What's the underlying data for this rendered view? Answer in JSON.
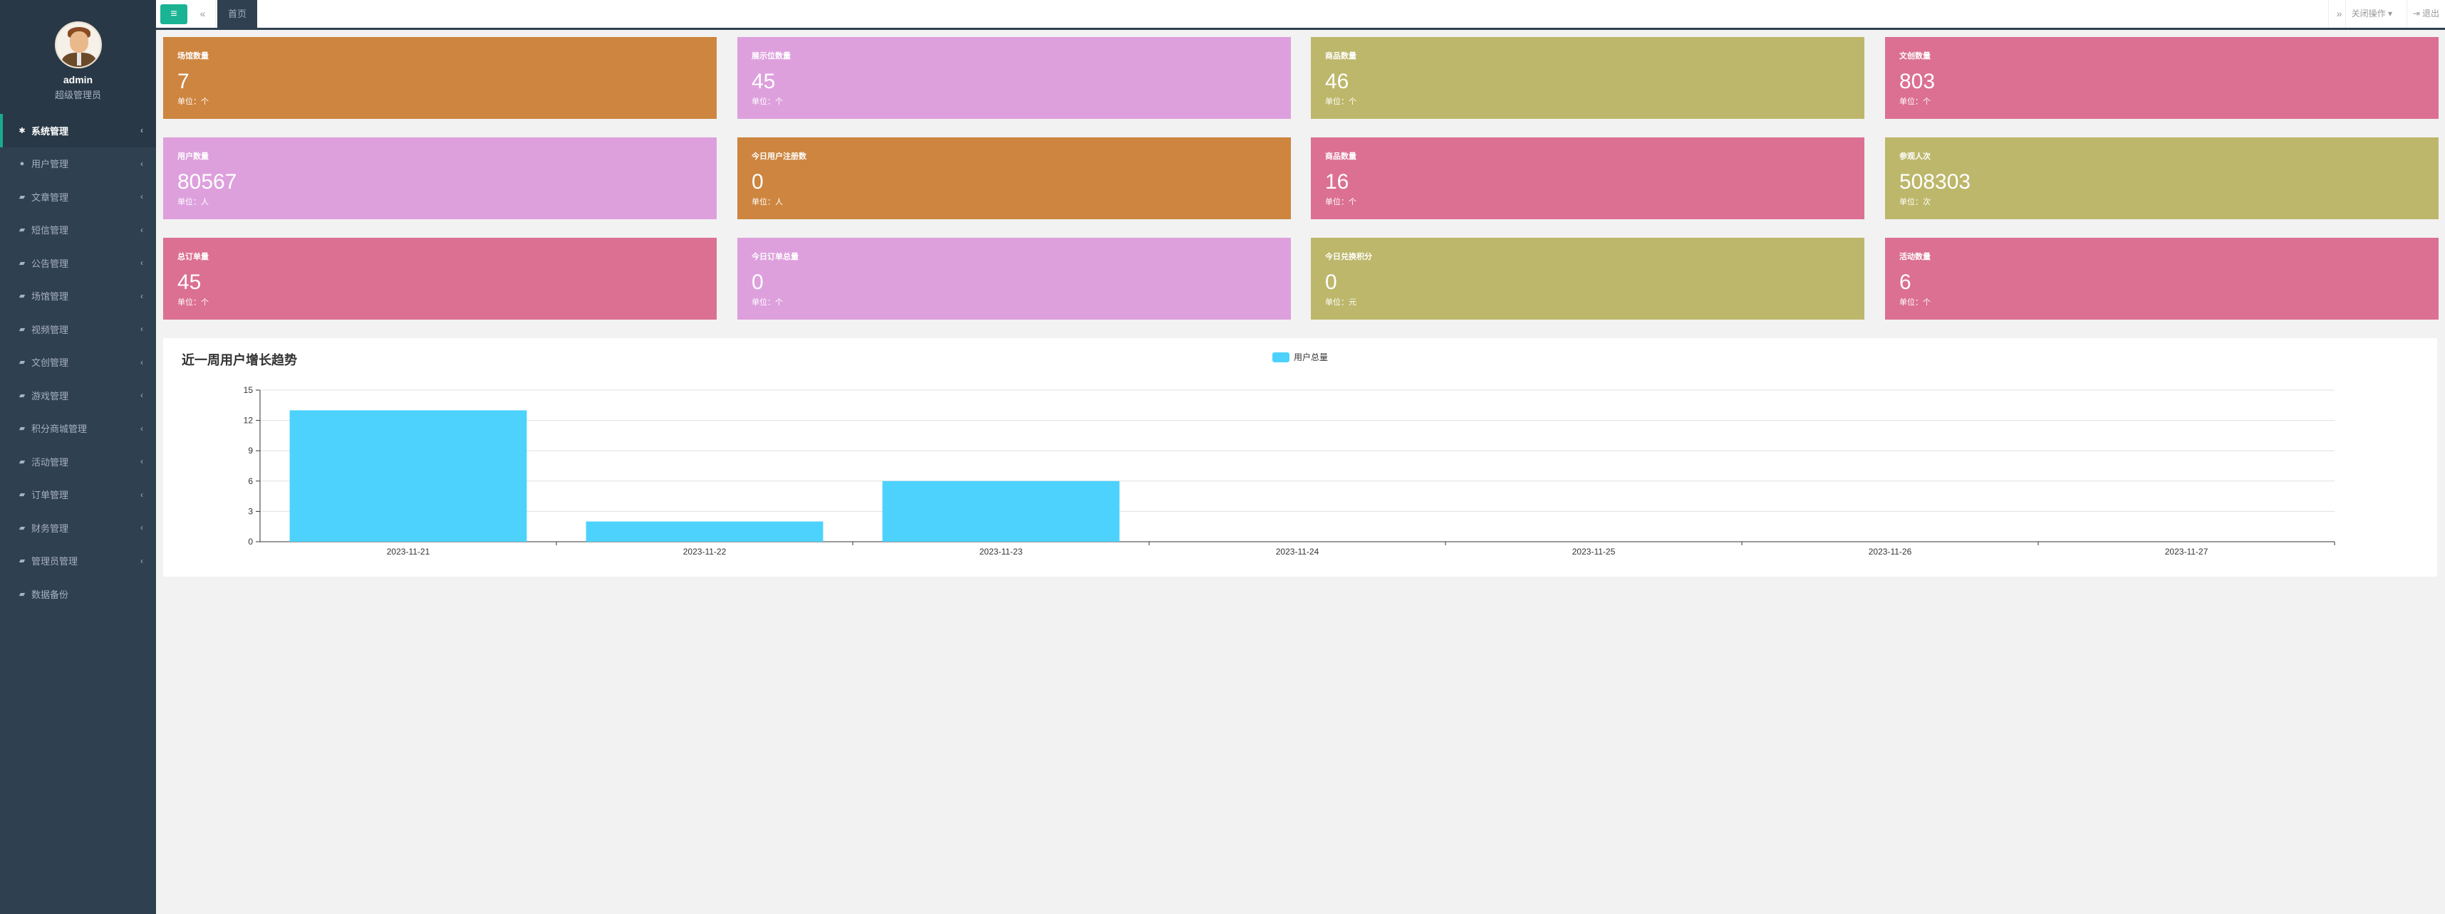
{
  "profile": {
    "name": "admin",
    "role": "超级管理员"
  },
  "sidebar": {
    "items": [
      {
        "label": "系统管理",
        "active": true
      },
      {
        "label": "用户管理"
      },
      {
        "label": "文章管理"
      },
      {
        "label": "短信管理"
      },
      {
        "label": "公告管理"
      },
      {
        "label": "场馆管理"
      },
      {
        "label": "视频管理"
      },
      {
        "label": "文创管理"
      },
      {
        "label": "游戏管理"
      },
      {
        "label": "积分商城管理"
      },
      {
        "label": "活动管理"
      },
      {
        "label": "订单管理"
      },
      {
        "label": "财务管理"
      },
      {
        "label": "管理员管理"
      },
      {
        "label": "数据备份"
      }
    ]
  },
  "topbar": {
    "menu_icon": "hamburger-icon",
    "home_tab": "首页",
    "close_ops": "关闭操作",
    "logout": "退出"
  },
  "cards": [
    {
      "title": "场馆数量",
      "value": "7",
      "unit": "单位：个",
      "color": "#cd853f"
    },
    {
      "title": "展示位数量",
      "value": "45",
      "unit": "单位：个",
      "color": "#dda0dd"
    },
    {
      "title": "商品数量",
      "value": "46",
      "unit": "单位：个",
      "color": "#bdb76b"
    },
    {
      "title": "文创数量",
      "value": "803",
      "unit": "单位：个",
      "color": "#db7093"
    },
    {
      "title": "用户数量",
      "value": "80567",
      "unit": "单位：人",
      "color": "#dda0dd"
    },
    {
      "title": "今日用户注册数",
      "value": "0",
      "unit": "单位：人",
      "color": "#cd853f"
    },
    {
      "title": "商品数量",
      "value": "16",
      "unit": "单位：个",
      "color": "#db7093"
    },
    {
      "title": "参观人次",
      "value": "508303",
      "unit": "单位：次",
      "color": "#bdb76b"
    },
    {
      "title": "总订单量",
      "value": "45",
      "unit": "单位：个",
      "color": "#db7093"
    },
    {
      "title": "今日订单总量",
      "value": "0",
      "unit": "单位：个",
      "color": "#dda0dd"
    },
    {
      "title": "今日兑换积分",
      "value": "0",
      "unit": "单位：元",
      "color": "#bdb76b"
    },
    {
      "title": "活动数量",
      "value": "6",
      "unit": "单位：个",
      "color": "#db7093"
    }
  ],
  "chart_data": {
    "type": "bar",
    "title": "近一周用户增长趋势",
    "categories": [
      "2023-11-21",
      "2023-11-22",
      "2023-11-23",
      "2023-11-24",
      "2023-11-25",
      "2023-11-26",
      "2023-11-27"
    ],
    "series": [
      {
        "name": "用户总量",
        "values": [
          13,
          2,
          6,
          0,
          0,
          0,
          0
        ]
      }
    ],
    "ylim": [
      0,
      15
    ],
    "yticks": [
      0,
      3,
      6,
      9,
      12,
      15
    ],
    "grid": true,
    "legend": "top-center",
    "bar_color": "#4cd2fd"
  }
}
